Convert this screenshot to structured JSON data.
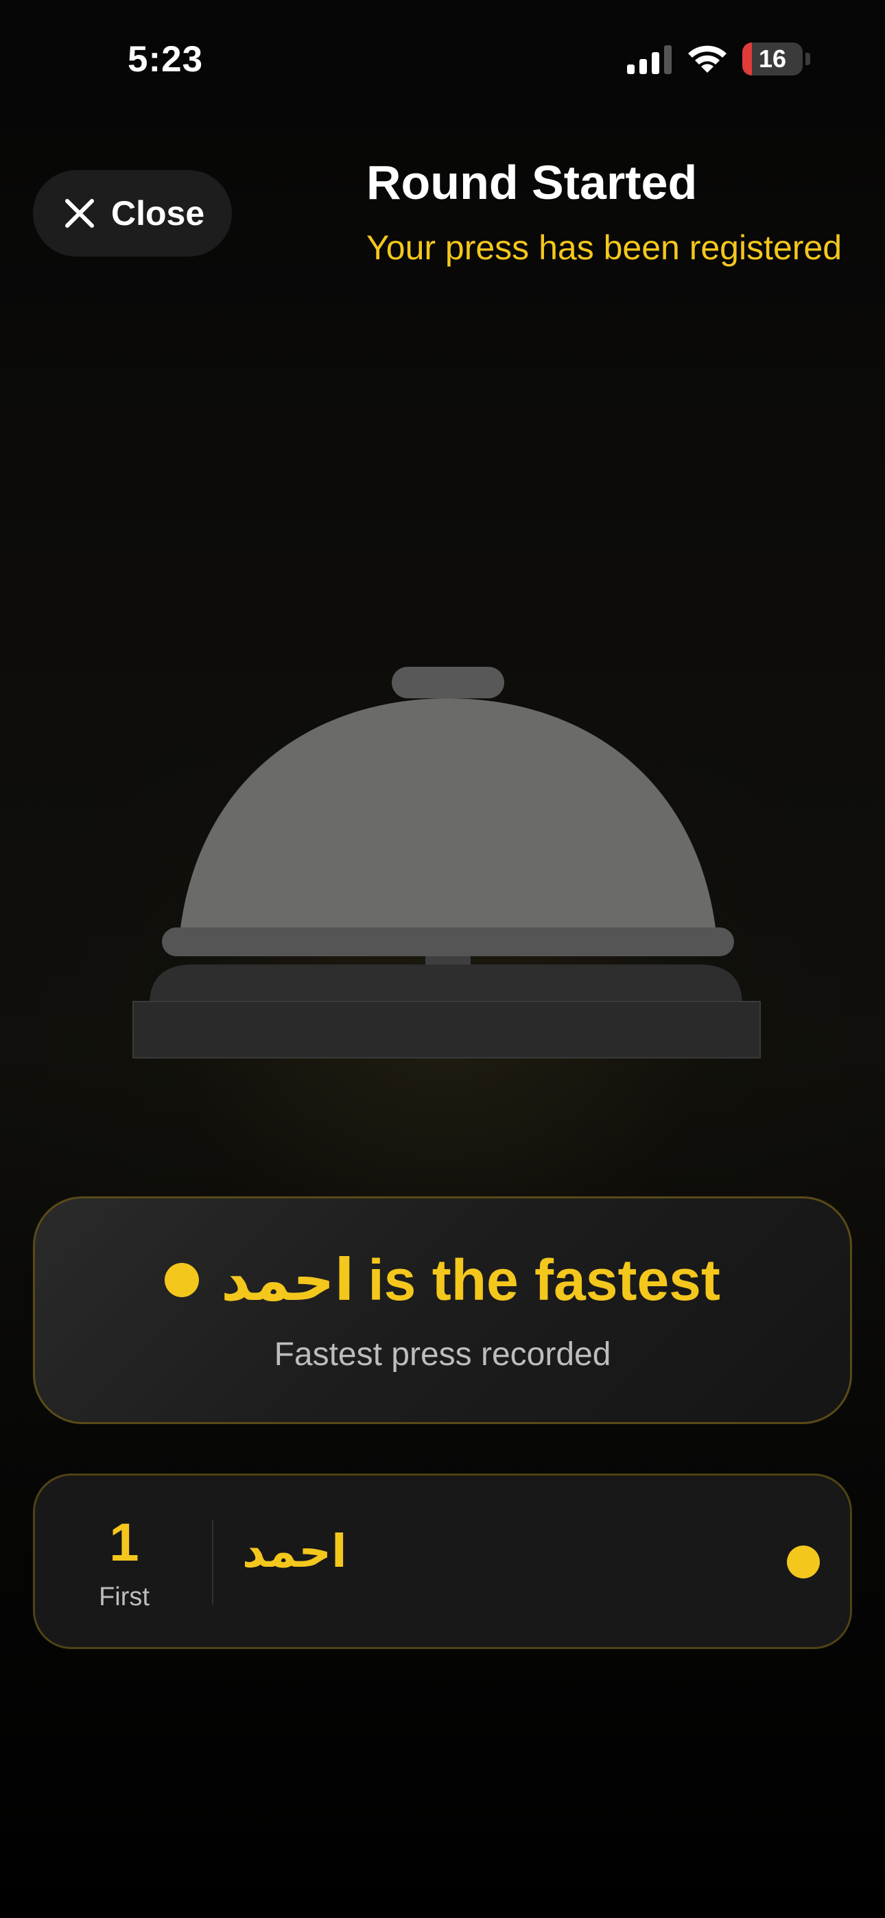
{
  "status_bar": {
    "time": "5:23",
    "battery_level": "16",
    "battery_fraction": 0.16,
    "icons": [
      "cellular-signal-icon",
      "wifi-icon",
      "battery-icon"
    ]
  },
  "header": {
    "close_label": "Close",
    "close_icon": "close-icon",
    "title": "Round Started",
    "subtitle": "Your press has been registered"
  },
  "bell": {
    "icon": "service-bell-icon"
  },
  "fastest_card": {
    "player_name": "احمد",
    "headline_suffix": "is the fastest",
    "caption": "Fastest press recorded"
  },
  "ranking": [
    {
      "rank": "1",
      "rank_label": "First",
      "name": "احمد"
    }
  ],
  "colors": {
    "accent": "#f4c71d",
    "background": "#0a0a0a",
    "card": "#1d1d1d",
    "battery_low": "#e23b3b"
  }
}
